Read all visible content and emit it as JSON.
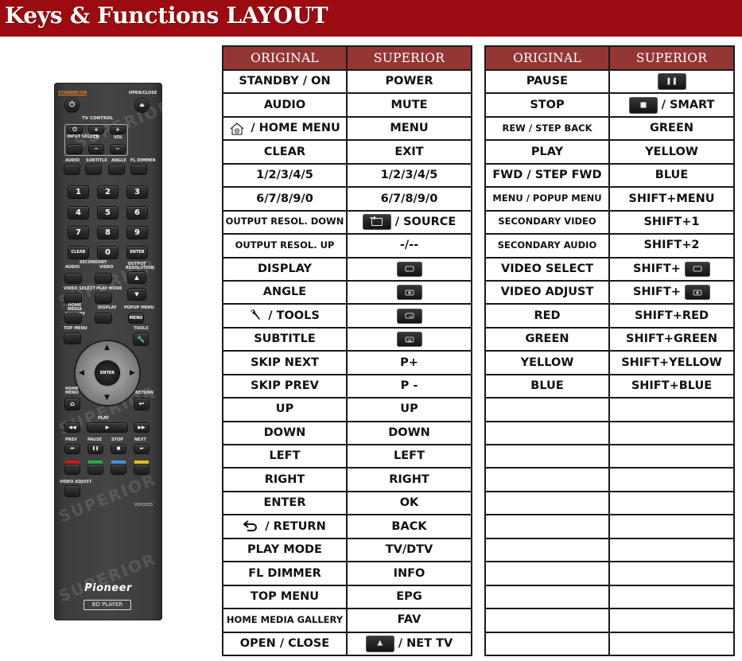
{
  "header": {
    "title": "Keys & Functions LAYOUT"
  },
  "colors": {
    "title_bar": "#9c0b12",
    "table_header": "#943634"
  },
  "remote": {
    "brand": "Pioneer",
    "model_badge": "BD PLAYER",
    "model_number": "VXX3333",
    "watermark": "SUPERIOR",
    "labels": {
      "standby": "STANDBY/ON",
      "open_close": "OPEN/CLOSE",
      "tv_control": "TV CONTROL",
      "input_select": "INPUT SELECT",
      "ch": "CH",
      "vol": "VOL",
      "audio": "AUDIO",
      "subtitle": "SUBTITLE",
      "angle": "ANGLE",
      "fl_dimmer": "FL DIMMER",
      "clear": "CLEAR",
      "enter": "ENTER",
      "secondary": "SECONDARY",
      "sec_audio": "AUDIO",
      "sec_video": "VIDEO",
      "output_resolution": "OUTPUT RESOLUTION",
      "video_select": "VIDEO SELECT",
      "play_mode": "PLAY MODE",
      "home_media_gallery": "HOME MEDIA GALLERY",
      "display": "DISPLAY",
      "popup_menu": "POPUP MENU",
      "menu": "MENU",
      "top_menu": "TOP MENU",
      "tools": "TOOLS",
      "home_menu": "HOME MENU",
      "return": "RETURN",
      "play": "PLAY",
      "prev": "PREV",
      "pause": "PAUSE",
      "stop": "STOP",
      "next": "NEXT",
      "video_adjust": "VIDEO ADJUST",
      "center_enter": "ENTER"
    },
    "numbers": [
      "1",
      "2",
      "3",
      "4",
      "5",
      "6",
      "7",
      "8",
      "9",
      "0"
    ]
  },
  "table_left": {
    "headers": [
      "ORIGINAL",
      "SUPERIOR"
    ],
    "rows": [
      {
        "original": "STANDBY / ON",
        "superior": "POWER"
      },
      {
        "original": "AUDIO",
        "superior": "MUTE"
      },
      {
        "original": "/ HOME MENU",
        "original_icon": "home-icon",
        "superior": "MENU"
      },
      {
        "original": "CLEAR",
        "superior": "EXIT"
      },
      {
        "original": "1/2/3/4/5",
        "superior": "1/2/3/4/5"
      },
      {
        "original": "6/7/8/9/0",
        "superior": "6/7/8/9/0"
      },
      {
        "original": "OUTPUT RESOL. DOWN",
        "superior": "/ SOURCE",
        "superior_icon": "source-key-icon"
      },
      {
        "original": "OUTPUT RESOL. UP",
        "superior": "-/--"
      },
      {
        "original": "DISPLAY",
        "superior": "",
        "superior_icon": "display-key-icon"
      },
      {
        "original": "ANGLE",
        "superior": "",
        "superior_icon": "angle-key-icon"
      },
      {
        "original": "/ TOOLS",
        "original_icon": "wrench-icon",
        "superior": "",
        "superior_icon": "tools-key-icon"
      },
      {
        "original": "SUBTITLE",
        "superior": "",
        "superior_icon": "subtitle-key-icon"
      },
      {
        "original": "SKIP NEXT",
        "superior": "P+"
      },
      {
        "original": "SKIP PREV",
        "superior": "P -"
      },
      {
        "original": "UP",
        "superior": "UP"
      },
      {
        "original": "DOWN",
        "superior": "DOWN"
      },
      {
        "original": "LEFT",
        "superior": "LEFT"
      },
      {
        "original": "RIGHT",
        "superior": "RIGHT"
      },
      {
        "original": "ENTER",
        "superior": "OK"
      },
      {
        "original": "/ RETURN",
        "original_icon": "return-arrow-icon",
        "superior": "BACK"
      },
      {
        "original": "PLAY MODE",
        "superior": "TV/DTV"
      },
      {
        "original": "FL DIMMER",
        "superior": "INFO"
      },
      {
        "original": "TOP MENU",
        "superior": "EPG"
      },
      {
        "original": "HOME MEDIA GALLERY",
        "superior": "FAV"
      },
      {
        "original": "OPEN / CLOSE",
        "superior": "/ NET TV",
        "superior_icon": "eject-key-icon"
      }
    ]
  },
  "table_right": {
    "headers": [
      "ORIGINAL",
      "SUPERIOR"
    ],
    "rows": [
      {
        "original": "PAUSE",
        "superior": "",
        "superior_icon": "pause-key-icon"
      },
      {
        "original": "STOP",
        "superior": "/ SMART",
        "superior_icon": "stop-key-icon"
      },
      {
        "original": "REW / STEP BACK",
        "superior": "GREEN"
      },
      {
        "original": "PLAY",
        "superior": "YELLOW"
      },
      {
        "original": "FWD / STEP FWD",
        "superior": "BLUE"
      },
      {
        "original": "MENU / POPUP MENU",
        "superior": "SHIFT+MENU"
      },
      {
        "original": "SECONDARY VIDEO",
        "superior": "SHIFT+1"
      },
      {
        "original": "SECONDARY AUDIO",
        "superior": "SHIFT+2"
      },
      {
        "original": "VIDEO SELECT",
        "superior": "SHIFT+",
        "superior_icon": "display-key-icon"
      },
      {
        "original": "VIDEO ADJUST",
        "superior": "SHIFT+",
        "superior_icon": "angle-key-icon"
      },
      {
        "original": "RED",
        "superior": "SHIFT+RED"
      },
      {
        "original": "GREEN",
        "superior": "SHIFT+GREEN"
      },
      {
        "original": "YELLOW",
        "superior": "SHIFT+YELLOW"
      },
      {
        "original": "BLUE",
        "superior": "SHIFT+BLUE"
      },
      {
        "original": "",
        "superior": ""
      },
      {
        "original": "",
        "superior": ""
      },
      {
        "original": "",
        "superior": ""
      },
      {
        "original": "",
        "superior": ""
      },
      {
        "original": "",
        "superior": ""
      },
      {
        "original": "",
        "superior": ""
      },
      {
        "original": "",
        "superior": ""
      },
      {
        "original": "",
        "superior": ""
      },
      {
        "original": "",
        "superior": ""
      },
      {
        "original": "",
        "superior": ""
      },
      {
        "original": "",
        "superior": ""
      }
    ]
  }
}
